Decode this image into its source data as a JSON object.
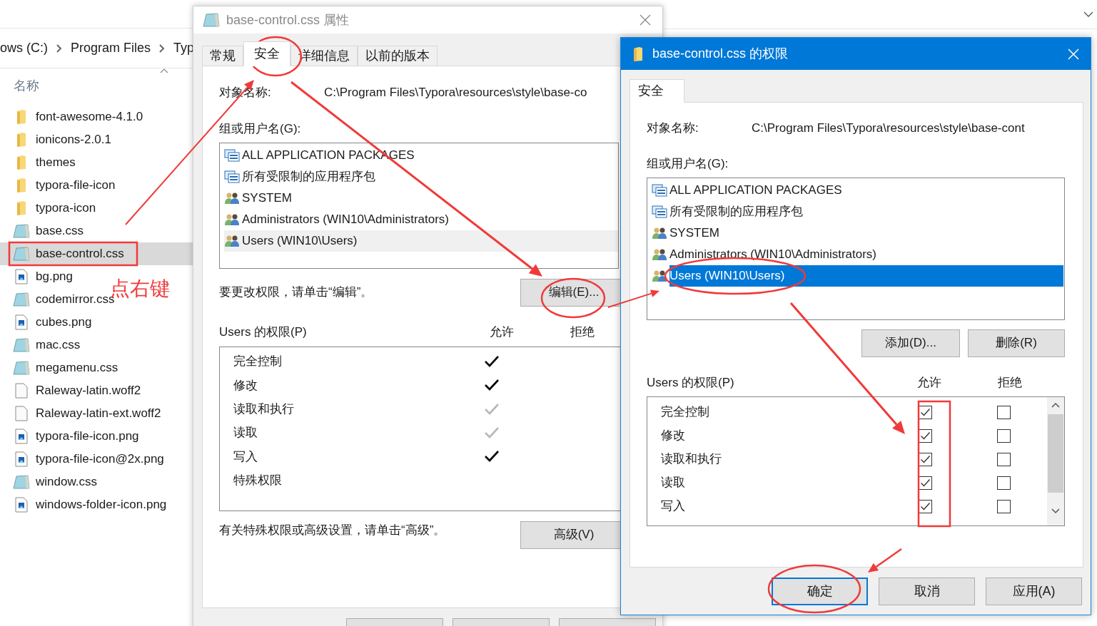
{
  "explorer": {
    "breadcrumb": [
      "ows (C:)",
      "Program Files",
      "Typ"
    ],
    "column_header": "名称",
    "files": [
      {
        "name": "font-awesome-4.1.0",
        "kind": "folder",
        "selected": false
      },
      {
        "name": "ionicons-2.0.1",
        "kind": "folder",
        "selected": false
      },
      {
        "name": "themes",
        "kind": "folder",
        "selected": false
      },
      {
        "name": "typora-file-icon",
        "kind": "folder",
        "selected": false
      },
      {
        "name": "typora-icon",
        "kind": "folder",
        "selected": false
      },
      {
        "name": "base.css",
        "kind": "css",
        "selected": false
      },
      {
        "name": "base-control.css",
        "kind": "css",
        "selected": true
      },
      {
        "name": "bg.png",
        "kind": "image",
        "selected": false
      },
      {
        "name": "codemirror.css",
        "kind": "css",
        "selected": false
      },
      {
        "name": "cubes.png",
        "kind": "image",
        "selected": false
      },
      {
        "name": "mac.css",
        "kind": "css",
        "selected": false
      },
      {
        "name": "megamenu.css",
        "kind": "css",
        "selected": false
      },
      {
        "name": "Raleway-latin.woff2",
        "kind": "file",
        "selected": false
      },
      {
        "name": "Raleway-latin-ext.woff2",
        "kind": "file",
        "selected": false
      },
      {
        "name": "typora-file-icon.png",
        "kind": "image",
        "selected": false
      },
      {
        "name": "typora-file-icon@2x.png",
        "kind": "image",
        "selected": false
      },
      {
        "name": "window.css",
        "kind": "css",
        "selected": false
      },
      {
        "name": "windows-folder-icon.png",
        "kind": "image",
        "selected": false
      }
    ]
  },
  "properties_dialog": {
    "title": "base-control.css 属性",
    "tabs": [
      {
        "label": "常规",
        "selected": false
      },
      {
        "label": "安全",
        "selected": true
      },
      {
        "label": "详细信息",
        "selected": false
      },
      {
        "label": "以前的版本",
        "selected": false
      }
    ],
    "object_name_label": "对象名称:",
    "object_name": "C:\\Program Files\\Typora\\resources\\style\\base-co",
    "group_label": "组或用户名(G):",
    "groups": [
      {
        "name": "ALL APPLICATION PACKAGES",
        "kind": "package",
        "selected": false
      },
      {
        "name": "所有受限制的应用程序包",
        "kind": "package",
        "selected": false
      },
      {
        "name": "SYSTEM",
        "kind": "users",
        "selected": false
      },
      {
        "name": "Administrators (WIN10\\Administrators)",
        "kind": "users",
        "selected": false
      },
      {
        "name": "Users (WIN10\\Users)",
        "kind": "users",
        "selected": true
      }
    ],
    "edit_hint": "要更改权限，请单击“编辑”。",
    "edit_button": "编辑(E)...",
    "permissions_label": "Users 的权限(P)",
    "allow_header": "允许",
    "deny_header": "拒绝",
    "permissions": [
      {
        "name": "完全控制",
        "kind": "granted"
      },
      {
        "name": "修改",
        "kind": "granted"
      },
      {
        "name": "读取和执行",
        "kind": "inherited"
      },
      {
        "name": "读取",
        "kind": "inherited"
      },
      {
        "name": "写入",
        "kind": "granted"
      },
      {
        "name": "特殊权限",
        "kind": "none"
      }
    ],
    "advanced_hint": "有关特殊权限或高级设置，请单击“高级”。",
    "advanced_button": "高级(V)"
  },
  "permissions_dialog": {
    "title": "base-control.css 的权限",
    "tabs": [
      {
        "label": "安全",
        "selected": true
      }
    ],
    "object_name_label": "对象名称:",
    "object_name": "C:\\Program Files\\Typora\\resources\\style\\base-cont",
    "group_label": "组或用户名(G):",
    "groups": [
      {
        "name": "ALL APPLICATION PACKAGES",
        "kind": "package",
        "selected": false
      },
      {
        "name": "所有受限制的应用程序包",
        "kind": "package",
        "selected": false
      },
      {
        "name": "SYSTEM",
        "kind": "users",
        "selected": false
      },
      {
        "name": "Administrators (WIN10\\Administrators)",
        "kind": "users",
        "selected": false
      },
      {
        "name": "Users (WIN10\\Users)",
        "kind": "users",
        "selected": true
      }
    ],
    "add_button": "添加(D)...",
    "remove_button": "删除(R)",
    "permissions_label": "Users 的权限(P)",
    "allow_header": "允许",
    "deny_header": "拒绝",
    "permissions": [
      {
        "name": "完全控制",
        "allow": true,
        "deny": false
      },
      {
        "name": "修改",
        "allow": true,
        "deny": false
      },
      {
        "name": "读取和执行",
        "allow": true,
        "deny": false
      },
      {
        "name": "读取",
        "allow": true,
        "deny": false
      },
      {
        "name": "写入",
        "allow": true,
        "deny": false
      }
    ],
    "buttons": [
      {
        "label": "确定",
        "default": true
      },
      {
        "label": "取消",
        "default": false
      },
      {
        "label": "应用(A)",
        "default": false
      }
    ]
  },
  "annotation": {
    "note": "点右键"
  }
}
